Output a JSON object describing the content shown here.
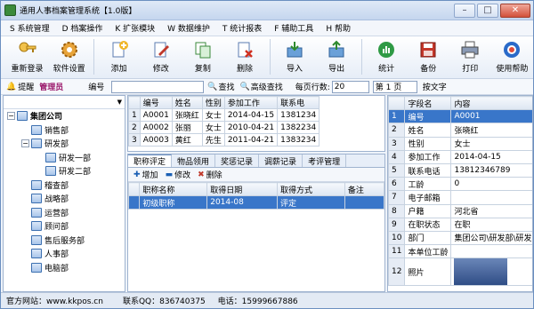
{
  "window": {
    "title": "通用人事档案管理系统【1.0版】"
  },
  "menu": [
    "S 系统管理",
    "D 档案操作",
    "K 扩张模块",
    "W 数据维护",
    "T 统计报表",
    "F 辅助工具",
    "H 帮助"
  ],
  "toolbar": {
    "buttons": [
      {
        "label": "重新登录",
        "icon": "key-icon"
      },
      {
        "label": "软件设置",
        "icon": "gear-icon"
      },
      {
        "label": "添加",
        "icon": "add-icon"
      },
      {
        "label": "修改",
        "icon": "edit-icon"
      },
      {
        "label": "复制",
        "icon": "copy-icon"
      },
      {
        "label": "删除",
        "icon": "delete-icon"
      },
      {
        "label": "导入",
        "icon": "import-icon"
      },
      {
        "label": "导出",
        "icon": "export-icon"
      },
      {
        "label": "统计",
        "icon": "stats-icon"
      },
      {
        "label": "备份",
        "icon": "backup-icon"
      },
      {
        "label": "打印",
        "icon": "print-icon"
      },
      {
        "label": "使用帮助",
        "icon": "help-icon"
      }
    ]
  },
  "searchbar": {
    "remind_label": "提醒",
    "user_label": "管理员",
    "field_select": "编号",
    "search_value": "",
    "search_button": "查找",
    "advanced_button": "高级查找",
    "rows_per_page_label": "每页行数:",
    "rows_per_page_value": "20",
    "page_label": "第 1 页",
    "sort_label": "按文字"
  },
  "tree": {
    "items": [
      {
        "label": "集团公司",
        "level": 0,
        "expander": "−"
      },
      {
        "label": "销售部",
        "level": 1,
        "expander": ""
      },
      {
        "label": "研发部",
        "level": 1,
        "expander": "−"
      },
      {
        "label": "研发一部",
        "level": 2,
        "expander": ""
      },
      {
        "label": "研发二部",
        "level": 2,
        "expander": ""
      },
      {
        "label": "稽查部",
        "level": 1,
        "expander": ""
      },
      {
        "label": "战略部",
        "level": 1,
        "expander": ""
      },
      {
        "label": "运营部",
        "level": 1,
        "expander": ""
      },
      {
        "label": "顾问部",
        "level": 1,
        "expander": ""
      },
      {
        "label": "售后服务部",
        "level": 1,
        "expander": ""
      },
      {
        "label": "人事部",
        "level": 1,
        "expander": ""
      },
      {
        "label": "电脑部",
        "level": 1,
        "expander": ""
      }
    ]
  },
  "grid": {
    "headers": [
      "",
      "编号",
      "姓名",
      "性别",
      "参加工作",
      "联系电"
    ],
    "rows": [
      [
        "1",
        "A0001",
        "张晓红",
        "女士",
        "2014-04-15",
        "1381234"
      ],
      [
        "2",
        "A0002",
        "张丽",
        "女士",
        "2010-04-21",
        "1382234"
      ],
      [
        "3",
        "A0003",
        "黄红",
        "先生",
        "2011-04-21",
        "1383234"
      ]
    ]
  },
  "tabs": {
    "labels": [
      "职称评定",
      "物品领用",
      "奖惩记录",
      "调薪记录",
      "考评管理"
    ],
    "sub_buttons": [
      "增加",
      "修改",
      "删除"
    ],
    "headers": [
      "职称名称",
      "取得日期",
      "取得方式",
      "备注"
    ],
    "rows": [
      [
        "初级职称",
        "2014-08",
        "评定",
        ""
      ]
    ]
  },
  "props": {
    "headers": [
      "",
      "字段名",
      "内容"
    ],
    "rows": [
      [
        "1",
        "编号",
        "A0001"
      ],
      [
        "2",
        "姓名",
        "张晓红"
      ],
      [
        "3",
        "性别",
        "女士"
      ],
      [
        "4",
        "参加工作",
        "2014-04-15"
      ],
      [
        "5",
        "联系电话",
        "13812346789"
      ],
      [
        "6",
        "工龄",
        "0"
      ],
      [
        "7",
        "电子邮箱",
        ""
      ],
      [
        "8",
        "户籍",
        "河北省"
      ],
      [
        "9",
        "在职状态",
        "在职"
      ],
      [
        "10",
        "部门",
        "集团公司\\研发部\\研发"
      ],
      [
        "11",
        "本单位工龄",
        ""
      ],
      [
        "12",
        "照片",
        ""
      ]
    ]
  },
  "status": {
    "website": "官方网站：www.kkpos.cn",
    "qq": "联系QQ：836740375",
    "phone": "电话：15999667886"
  },
  "colors": {
    "accent": "#3976c9",
    "frame": "#6b8fc0",
    "user_label": "#9b1a6c"
  }
}
